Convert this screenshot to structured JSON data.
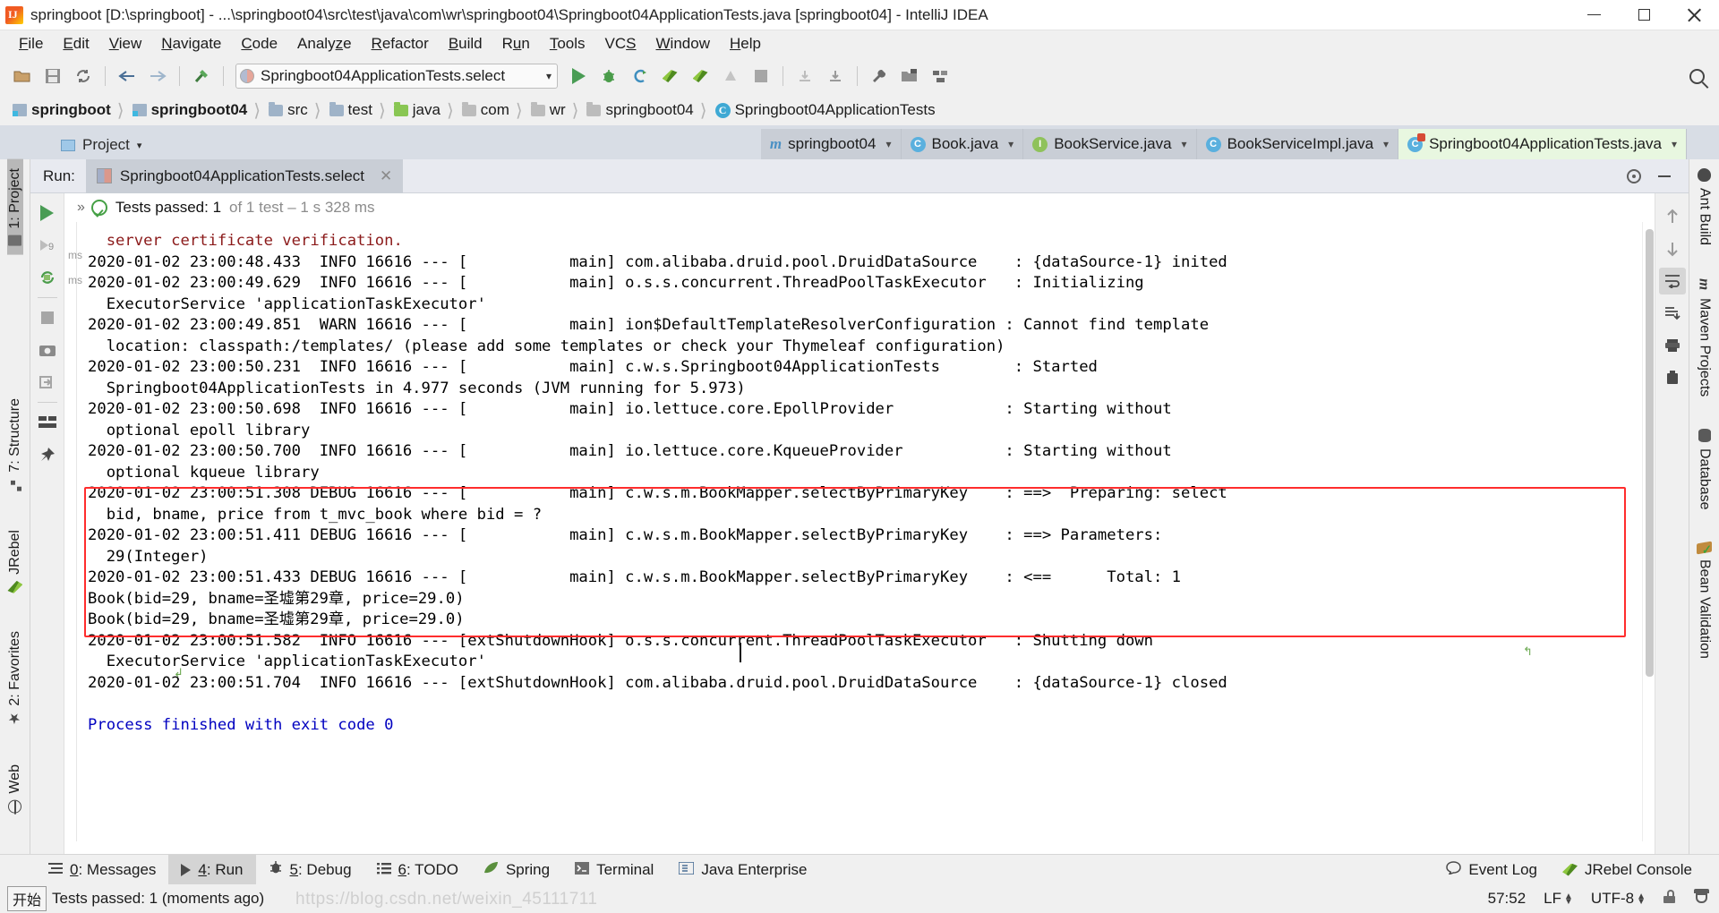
{
  "window": {
    "title": "springboot [D:\\springboot] - ...\\springboot04\\src\\test\\java\\com\\wr\\springboot04\\Springboot04ApplicationTests.java [springboot04] - IntelliJ IDEA",
    "app_icon": "intellij-idea-icon",
    "minimize_label": "Minimize",
    "maximize_label": "Restore",
    "close_label": "Close"
  },
  "menubar": {
    "items": [
      {
        "label": "File",
        "mnemonic": "F"
      },
      {
        "label": "Edit",
        "mnemonic": "E"
      },
      {
        "label": "View",
        "mnemonic": "V"
      },
      {
        "label": "Navigate",
        "mnemonic": "N"
      },
      {
        "label": "Code",
        "mnemonic": "C"
      },
      {
        "label": "Analyze",
        "mnemonic": "z"
      },
      {
        "label": "Refactor",
        "mnemonic": "R"
      },
      {
        "label": "Build",
        "mnemonic": "B"
      },
      {
        "label": "Run",
        "mnemonic": "u"
      },
      {
        "label": "Tools",
        "mnemonic": "T"
      },
      {
        "label": "VCS",
        "mnemonic": "S"
      },
      {
        "label": "Window",
        "mnemonic": "W"
      },
      {
        "label": "Help",
        "mnemonic": "H"
      }
    ]
  },
  "toolbar": {
    "run_configuration": "Springboot04ApplicationTests.select",
    "caret": "∨",
    "icons": [
      "open-project-icon",
      "save-all-icon",
      "sync-icon",
      "back-icon",
      "forward-icon",
      "build-hammer-icon",
      "run-icon",
      "debug-icon",
      "run-coverage-icon",
      "jrebel-run-icon",
      "jrebel-debug-icon",
      "stop-gray-icon",
      "stop-icon",
      "update-app-icon",
      "download-icon",
      "settings-wrench-icon",
      "project-structure-icon",
      "sdk-icon",
      "search-everywhere-icon"
    ]
  },
  "breadcrumb": {
    "items": [
      {
        "label": "springboot",
        "icon": "module-icon",
        "bold": true
      },
      {
        "label": "springboot04",
        "icon": "module-icon",
        "bold": true
      },
      {
        "label": "src",
        "icon": "folder-icon",
        "bold": false
      },
      {
        "label": "test",
        "icon": "folder-icon",
        "bold": false
      },
      {
        "label": "java",
        "icon": "source-root-folder-icon",
        "bold": false
      },
      {
        "label": "com",
        "icon": "package-icon",
        "bold": false
      },
      {
        "label": "wr",
        "icon": "package-icon",
        "bold": false
      },
      {
        "label": "springboot04",
        "icon": "package-icon",
        "bold": false
      },
      {
        "label": "Springboot04ApplicationTests",
        "icon": "test-class-icon",
        "bold": false
      }
    ],
    "separator": "›"
  },
  "editor_tabs": {
    "tool_label": "Project",
    "tabs": [
      {
        "label": "springboot04",
        "icon": "maven-pom-icon",
        "active": false
      },
      {
        "label": "Book.java",
        "icon": "class-icon",
        "active": false
      },
      {
        "label": "BookService.java",
        "icon": "interface-icon",
        "active": false
      },
      {
        "label": "BookServiceImpl.java",
        "icon": "class-icon",
        "active": false
      },
      {
        "label": "Springboot04ApplicationTests.java",
        "icon": "test-class-icon",
        "active": true
      }
    ]
  },
  "left_tool_tabs": [
    {
      "label": "1: Project",
      "mnemonic": "1",
      "icon": "project-folder-icon",
      "active": true
    },
    {
      "label": "7: Structure",
      "mnemonic": "7",
      "icon": "structure-icon",
      "active": false
    },
    {
      "label": "JRebel",
      "mnemonic": "",
      "icon": "jrebel-icon",
      "active": false
    },
    {
      "label": "2: Favorites",
      "mnemonic": "2",
      "icon": "star-icon",
      "active": false
    },
    {
      "label": "Web",
      "mnemonic": "",
      "icon": "web-globe-icon",
      "active": false
    }
  ],
  "right_tool_tabs": [
    {
      "label": "Ant Build",
      "icon": "ant-icon"
    },
    {
      "label": "Maven Projects",
      "icon": "maven-icon"
    },
    {
      "label": "Database",
      "icon": "database-icon"
    },
    {
      "label": "Bean Validation",
      "icon": "bean-validation-icon"
    }
  ],
  "right_gutter_icons": [
    "up-arrow-icon",
    "down-arrow-icon",
    "soft-wrap-icon",
    "scroll-to-end-icon",
    "print-icon",
    "clear-all-icon"
  ],
  "run_panel": {
    "label": "Run:",
    "tab_title": "Springboot04ApplicationTests.select",
    "tab_icon": "run-config-icon",
    "close_icon": "close-icon",
    "settings_icon": "gear-icon",
    "hide_icon": "minimize-icon",
    "toolbar_icons": [
      "rerun-icon",
      "rerun-failed-icon",
      "restart-icon",
      "stop-icon",
      "screenshot-icon",
      "export-icon",
      "layout-icon",
      "pin-icon"
    ],
    "status": {
      "expand_icon": "»",
      "result_icon": "test-passed-icon",
      "main": "Tests passed: 1",
      "detail": "of 1 test – 1 s 328 ms"
    },
    "gutter_marks": [
      "ms",
      "ms"
    ]
  },
  "console": {
    "lines": [
      {
        "text": "  server certificate verification.",
        "color": "dark-red"
      },
      {
        "text": "2020-01-02 23:00:48.433  INFO 16616 --- [           main] com.alibaba.druid.pool.DruidDataSource    : {dataSource-1} inited",
        "color": "black"
      },
      {
        "text": "2020-01-02 23:00:49.629  INFO 16616 --- [           main] o.s.s.concurrent.ThreadPoolTaskExecutor   : Initializing",
        "color": "black"
      },
      {
        "text": "  ExecutorService 'applicationTaskExecutor'",
        "color": "black"
      },
      {
        "text": "2020-01-02 23:00:49.851  WARN 16616 --- [           main] ion$DefaultTemplateResolverConfiguration : Cannot find template",
        "color": "black"
      },
      {
        "text": "  location: classpath:/templates/ (please add some templates or check your Thymeleaf configuration)",
        "color": "black"
      },
      {
        "text": "2020-01-02 23:00:50.231  INFO 16616 --- [           main] c.w.s.Springboot04ApplicationTests        : Started",
        "color": "black"
      },
      {
        "text": "  Springboot04ApplicationTests in 4.977 seconds (JVM running for 5.973)",
        "color": "black"
      },
      {
        "text": "2020-01-02 23:00:50.698  INFO 16616 --- [           main] io.lettuce.core.EpollProvider            : Starting without",
        "color": "black"
      },
      {
        "text": "  optional epoll library",
        "color": "black"
      },
      {
        "text": "2020-01-02 23:00:50.700  INFO 16616 --- [           main] io.lettuce.core.KqueueProvider           : Starting without",
        "color": "black"
      },
      {
        "text": "  optional kqueue library",
        "color": "black"
      },
      {
        "text": "2020-01-02 23:00:51.308 DEBUG 16616 --- [           main] c.w.s.m.BookMapper.selectByPrimaryKey    : ==>  Preparing: select",
        "color": "black"
      },
      {
        "text": "  bid, bname, price from t_mvc_book where bid = ?",
        "color": "black"
      },
      {
        "text": "2020-01-02 23:00:51.411 DEBUG 16616 --- [           main] c.w.s.m.BookMapper.selectByPrimaryKey    : ==> Parameters:",
        "color": "black"
      },
      {
        "text": "  29(Integer)",
        "color": "black"
      },
      {
        "text": "2020-01-02 23:00:51.433 DEBUG 16616 --- [           main] c.w.s.m.BookMapper.selectByPrimaryKey    : <==      Total: 1",
        "color": "black"
      },
      {
        "text": "Book(bid=29, bname=圣墟第29章, price=29.0)",
        "color": "black"
      },
      {
        "text": "Book(bid=29, bname=圣墟第29章, price=29.0)",
        "color": "black"
      },
      {
        "text": "2020-01-02 23:00:51.582  INFO 16616 --- [extShutdownHook] o.s.s.concurrent.ThreadPoolTaskExecutor   : Shutting down",
        "color": "black"
      },
      {
        "text": "  ExecutorService 'applicationTaskExecutor'",
        "color": "black"
      },
      {
        "text": "2020-01-02 23:00:51.704  INFO 16616 --- [extShutdownHook] com.alibaba.druid.pool.DruidDataSource    : {dataSource-1} closed",
        "color": "black"
      },
      {
        "text": "",
        "color": "black"
      },
      {
        "text": "Process finished with exit code 0",
        "color": "blue"
      }
    ],
    "highlight_note": "red-rectangle-around-mybatis-debug-output"
  },
  "bottom_tabs": [
    {
      "label": "0: Messages",
      "mnemonic": "0",
      "icon": "messages-icon",
      "active": false
    },
    {
      "label": "4: Run",
      "mnemonic": "4",
      "icon": "run-icon",
      "active": true
    },
    {
      "label": "5: Debug",
      "mnemonic": "5",
      "icon": "debug-icon",
      "active": false
    },
    {
      "label": "6: TODO",
      "mnemonic": "6",
      "icon": "todo-icon",
      "active": false
    },
    {
      "label": "Spring",
      "mnemonic": "",
      "icon": "spring-leaf-icon",
      "active": false
    },
    {
      "label": "Terminal",
      "mnemonic": "",
      "icon": "terminal-icon",
      "active": false
    },
    {
      "label": "Java Enterprise",
      "mnemonic": "",
      "icon": "java-enterprise-icon",
      "active": false
    }
  ],
  "bottom_right_tabs": [
    {
      "label": "Event Log",
      "icon": "event-log-icon"
    },
    {
      "label": "JRebel Console",
      "icon": "jrebel-icon"
    }
  ],
  "statusbar": {
    "ime_badge": "开始",
    "message": "Tests passed: 1 (moments ago)",
    "caret_position": "57:52",
    "line_separator": "LF",
    "encoding": "UTF-8",
    "lock_icon": "unlocked-icon",
    "inspection_icon": "inspector-face-icon",
    "watermark": "https://blog.csdn.net/weixin_45111711"
  },
  "colors": {
    "accent_red": "#ff2d2d",
    "pass_green": "#45a045",
    "link_blue": "#0000c0",
    "warn_dark_red": "#8b1a1a",
    "active_tab_green": "#e8f7e0"
  }
}
